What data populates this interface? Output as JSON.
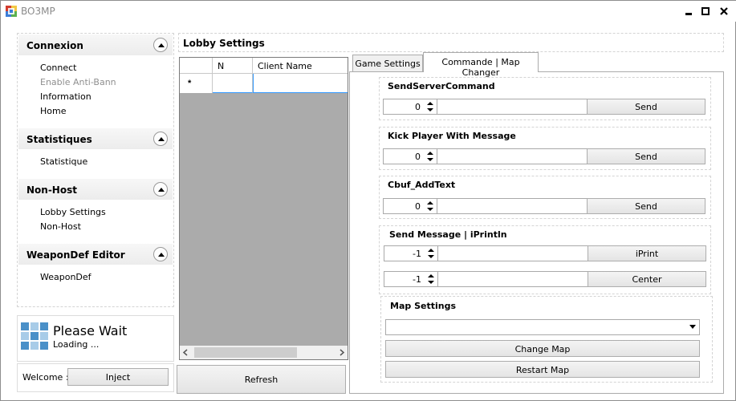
{
  "window": {
    "title": "BO3MP",
    "minimize_glyph": "▬",
    "maximize_glyph": "■",
    "close_glyph": "✕"
  },
  "sidebar": {
    "sections": [
      {
        "title": "Connexion",
        "items": [
          {
            "label": "Connect",
            "enabled": true
          },
          {
            "label": "Enable Anti-Bann",
            "enabled": false
          },
          {
            "label": "Information",
            "enabled": true
          },
          {
            "label": "Home",
            "enabled": true
          }
        ]
      },
      {
        "title": "Statistiques",
        "items": [
          {
            "label": "Statistique",
            "enabled": true
          }
        ]
      },
      {
        "title": "Non-Host",
        "items": [
          {
            "label": "Lobby Settings",
            "enabled": true
          },
          {
            "label": "Non-Host",
            "enabled": true
          }
        ]
      },
      {
        "title": "WeaponDef Editor",
        "items": [
          {
            "label": "WeaponDef",
            "enabled": true
          }
        ]
      }
    ],
    "status": {
      "title": "Please Wait",
      "subtitle": "Loading ..."
    },
    "footer": {
      "welcome_label": "Welcome :",
      "inject_label": "Inject"
    }
  },
  "lobby": {
    "title": "Lobby Settings",
    "columns": [
      "N",
      "Client Name"
    ],
    "new_row_marker": "*",
    "refresh_label": "Refresh"
  },
  "tabs": [
    {
      "label": "Game Settings",
      "active": false
    },
    {
      "label": "Commande | Map Changer",
      "active": true
    }
  ],
  "commands": {
    "send_server_command": {
      "title": "SendServerCommand",
      "value": "0",
      "button": "Send"
    },
    "kick_player": {
      "title": "Kick Player With Message",
      "value": "0",
      "button": "Send"
    },
    "cbuf_addtext": {
      "title": "Cbuf_AddText",
      "value": "0",
      "button": "Send"
    },
    "send_message": {
      "title": "Send Message  |  iPrintln",
      "iprint": {
        "value": "-1",
        "button": "iPrint"
      },
      "center": {
        "value": "-1",
        "button": "Center"
      }
    },
    "map_settings": {
      "title": "Map Settings",
      "selected_map": "",
      "change_label": "Change Map",
      "restart_label": "Restart Map"
    }
  },
  "icons": {
    "app": "bo3mp-app-icon",
    "collapse": "chevron-up-icon",
    "loading": "loading-grid-icon",
    "dropdown": "caret-down-icon"
  },
  "colors": {
    "grid_background": "#ababab",
    "disabled_text": "#8f8f8f",
    "selection_blue": "#3399ff",
    "loading_blue_dark": "#4a90c8",
    "loading_blue_light": "#a8cce8"
  }
}
